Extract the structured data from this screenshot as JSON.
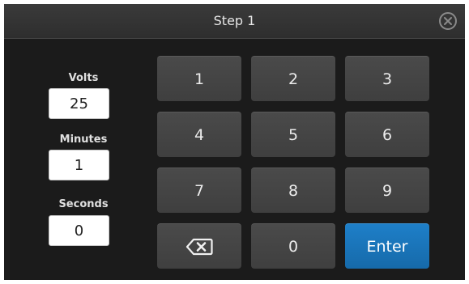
{
  "header": {
    "title": "Step 1",
    "close_icon": "close-circle-icon"
  },
  "fields": [
    {
      "label": "Volts",
      "value": "25"
    },
    {
      "label": "Minutes",
      "value": "1"
    },
    {
      "label": "Seconds",
      "value": "0"
    }
  ],
  "keypad": {
    "keys": [
      "1",
      "2",
      "3",
      "4",
      "5",
      "6",
      "7",
      "8",
      "9"
    ],
    "backspace_icon": "backspace-icon",
    "zero": "0",
    "enter": "Enter"
  },
  "colors": {
    "enter": "#1e7fc8",
    "key": "#444444",
    "background": "#1b1b1b"
  }
}
